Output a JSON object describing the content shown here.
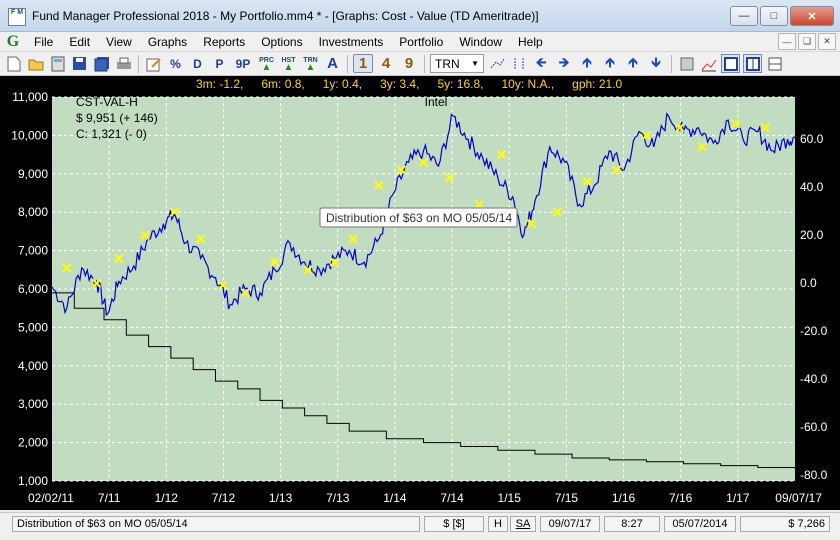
{
  "window": {
    "title": "Fund Manager Professional 2018 - My Portfolio.mm4 * - [Graphs: Cost - Value (TD Ameritrade)]",
    "icon_text_top": "F M",
    "minimize_icon": "minimize-icon",
    "maximize_icon": "maximize-icon",
    "close_icon": "close-icon"
  },
  "menu": {
    "app_glyph": "G",
    "items": [
      "File",
      "Edit",
      "View",
      "Graphs",
      "Reports",
      "Options",
      "Investments",
      "Portfolio",
      "Window",
      "Help"
    ]
  },
  "toolbar": {
    "text_buttons": [
      "D",
      "P",
      "9P"
    ],
    "small_buttons": [
      {
        "top": "PRC",
        "icon": "up-arrow-icon"
      },
      {
        "top": "HST",
        "icon": "up-arrow-icon"
      },
      {
        "top": "TRN",
        "icon": "up-arrow-icon"
      }
    ],
    "a_button": "A",
    "period_buttons": [
      "1",
      "4",
      "9"
    ],
    "active_period": "1",
    "select_value": "TRN",
    "percent_button": "%"
  },
  "stats": {
    "items": [
      "3m: -1.2,",
      "6m: 0.8,",
      "1y: 0.4,",
      "3y: 3.4,",
      "5y: 16.8,",
      "10y: N.A.,",
      "gph: 21.0"
    ]
  },
  "chart_data": {
    "type": "line",
    "legend": {
      "code": "CST-VAL-H",
      "value": "$ 9,951 (+ 146)",
      "cost": "C: 1,321 (- 0)"
    },
    "series_label": "Intel",
    "y_left": {
      "ticks": [
        "1,000",
        "2,000",
        "3,000",
        "4,000",
        "5,000",
        "6,000",
        "7,000",
        "8,000",
        "9,000",
        "10,000",
        "11,000"
      ],
      "range": [
        1000,
        11000
      ]
    },
    "y_right": {
      "ticks": [
        "-80.0",
        "-60.0",
        "-40.0",
        "-20.0",
        "0.0",
        "20.0",
        "40.0",
        "60.0"
      ],
      "range": [
        -80,
        60
      ]
    },
    "x_ticks": [
      "02/02/11",
      "7/11",
      "1/12",
      "7/12",
      "1/13",
      "7/13",
      "1/14",
      "7/14",
      "1/15",
      "7/15",
      "1/16",
      "7/16",
      "1/17",
      "09/07/17"
    ],
    "colors": {
      "background": "#c2dcc2",
      "value_line": "#0000cc",
      "cost_line": "#000000",
      "marker": "#ffff00",
      "highlight_marker": "#ff00ff",
      "grid": "#ffffff"
    },
    "tooltip": "Distribution of $63 on MO 05/05/14",
    "value_series": [
      [
        0.0,
        6050
      ],
      [
        0.02,
        5500
      ],
      [
        0.04,
        6550
      ],
      [
        0.06,
        6200
      ],
      [
        0.075,
        5350
      ],
      [
        0.09,
        6200
      ],
      [
        0.11,
        6600
      ],
      [
        0.13,
        7300
      ],
      [
        0.15,
        7700
      ],
      [
        0.165,
        7950
      ],
      [
        0.18,
        7200
      ],
      [
        0.2,
        6800
      ],
      [
        0.22,
        6300
      ],
      [
        0.24,
        5600
      ],
      [
        0.26,
        6000
      ],
      [
        0.28,
        5900
      ],
      [
        0.3,
        6500
      ],
      [
        0.32,
        7200
      ],
      [
        0.34,
        6700
      ],
      [
        0.36,
        6500
      ],
      [
        0.38,
        6800
      ],
      [
        0.4,
        7000
      ],
      [
        0.42,
        6700
      ],
      [
        0.44,
        7300
      ],
      [
        0.46,
        8500
      ],
      [
        0.48,
        9300
      ],
      [
        0.5,
        9600
      ],
      [
        0.52,
        9200
      ],
      [
        0.54,
        10500
      ],
      [
        0.56,
        9900
      ],
      [
        0.58,
        9400
      ],
      [
        0.6,
        8900
      ],
      [
        0.62,
        8400
      ],
      [
        0.635,
        7400
      ],
      [
        0.65,
        8300
      ],
      [
        0.67,
        9700
      ],
      [
        0.69,
        9300
      ],
      [
        0.71,
        8200
      ],
      [
        0.73,
        8700
      ],
      [
        0.75,
        9600
      ],
      [
        0.77,
        9100
      ],
      [
        0.79,
        10100
      ],
      [
        0.81,
        9700
      ],
      [
        0.83,
        10500
      ],
      [
        0.85,
        10100
      ],
      [
        0.87,
        10200
      ],
      [
        0.89,
        9800
      ],
      [
        0.91,
        10400
      ],
      [
        0.93,
        9900
      ],
      [
        0.95,
        10100
      ],
      [
        0.97,
        9600
      ],
      [
        0.99,
        9900
      ],
      [
        1.0,
        9950
      ]
    ],
    "cost_series": [
      [
        0.0,
        5900
      ],
      [
        0.03,
        5500
      ],
      [
        0.07,
        5200
      ],
      [
        0.1,
        4800
      ],
      [
        0.13,
        4500
      ],
      [
        0.16,
        4200
      ],
      [
        0.19,
        3900
      ],
      [
        0.22,
        3600
      ],
      [
        0.25,
        3400
      ],
      [
        0.28,
        3100
      ],
      [
        0.31,
        2900
      ],
      [
        0.34,
        2700
      ],
      [
        0.37,
        2500
      ],
      [
        0.4,
        2300
      ],
      [
        0.45,
        2100
      ],
      [
        0.5,
        2000
      ],
      [
        0.55,
        1900
      ],
      [
        0.6,
        1800
      ],
      [
        0.65,
        1700
      ],
      [
        0.7,
        1600
      ],
      [
        0.75,
        1550
      ],
      [
        0.8,
        1500
      ],
      [
        0.85,
        1450
      ],
      [
        0.9,
        1400
      ],
      [
        0.95,
        1350
      ],
      [
        1.0,
        1320
      ]
    ],
    "markers": [
      [
        0.02,
        6550
      ],
      [
        0.06,
        6150
      ],
      [
        0.09,
        6800
      ],
      [
        0.125,
        7400
      ],
      [
        0.165,
        8000
      ],
      [
        0.2,
        7300
      ],
      [
        0.23,
        6100
      ],
      [
        0.26,
        5900
      ],
      [
        0.3,
        6700
      ],
      [
        0.345,
        6500
      ],
      [
        0.38,
        6700
      ],
      [
        0.405,
        7300
      ],
      [
        0.44,
        8700
      ],
      [
        0.47,
        9100
      ],
      [
        0.5,
        9300
      ],
      [
        0.535,
        8900
      ],
      [
        0.575,
        8200
      ],
      [
        0.605,
        9500
      ],
      [
        0.645,
        7700
      ],
      [
        0.68,
        8000
      ],
      [
        0.72,
        8800
      ],
      [
        0.76,
        9100
      ],
      [
        0.8,
        10000
      ],
      [
        0.845,
        10200
      ],
      [
        0.875,
        9700
      ],
      [
        0.92,
        10300
      ],
      [
        0.96,
        10200
      ]
    ],
    "highlight_marker": [
      0.58,
      7950
    ]
  },
  "status": {
    "message": "Distribution of $63 on MO 05/05/14",
    "currency": "$ [$]",
    "h": "H",
    "sa": "SA",
    "date": "09/07/17",
    "time": "8:27",
    "point_date": "05/07/2014",
    "point_value": "$ 7,266"
  }
}
